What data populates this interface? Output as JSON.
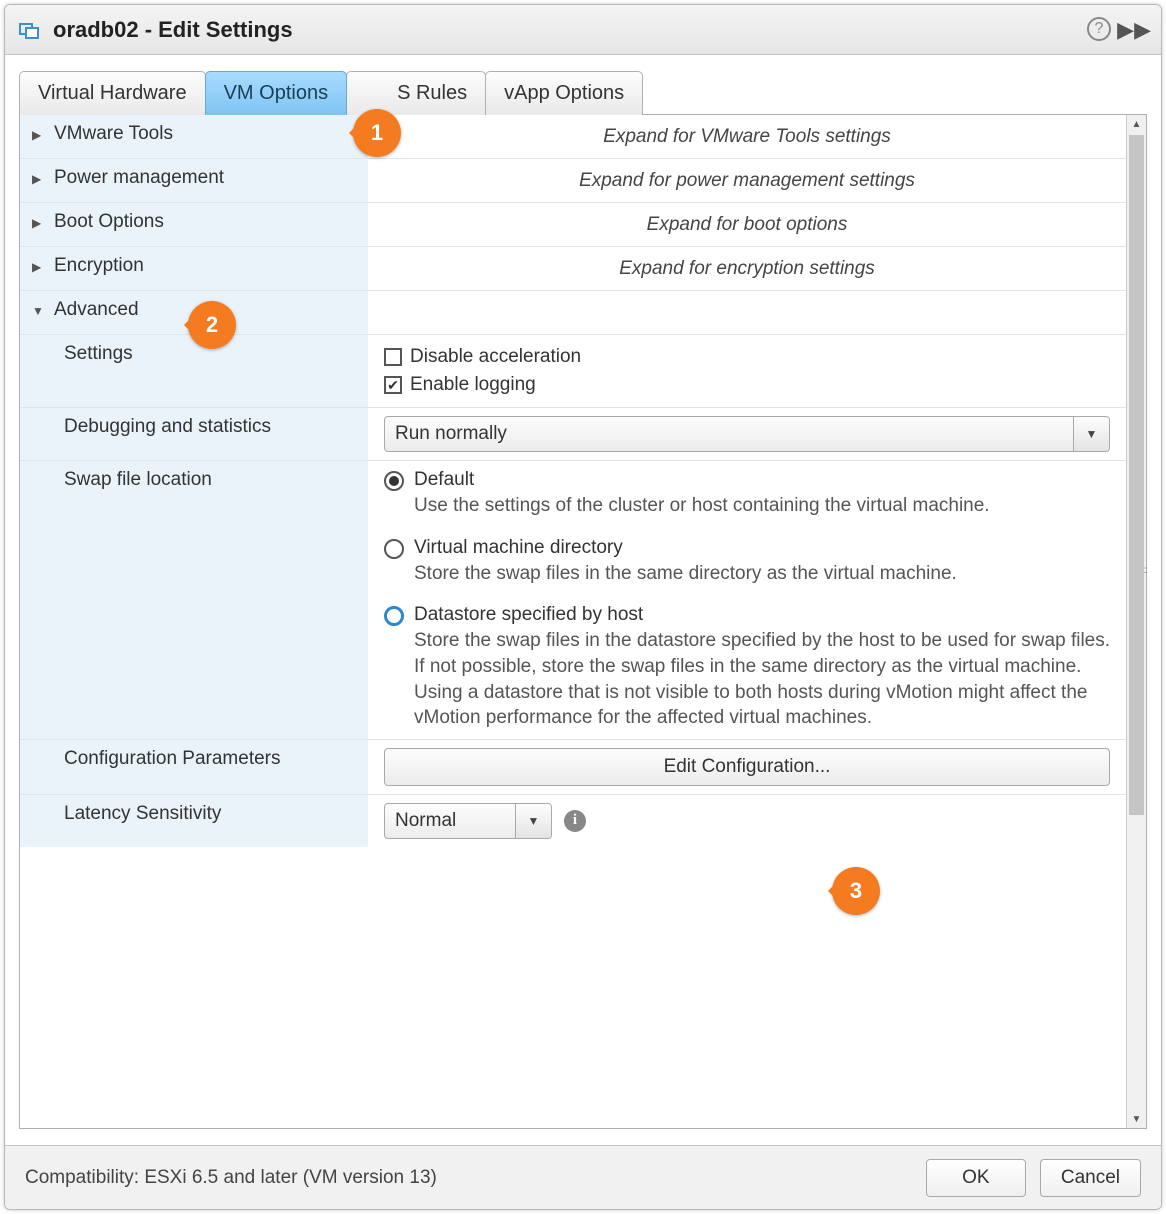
{
  "title": "oradb02 - Edit Settings",
  "tabs": {
    "virtual_hardware": "Virtual Hardware",
    "vm_options": "VM Options",
    "sdrs_rules": "S Rules",
    "vapp_options": "vApp Options"
  },
  "sections": {
    "vmware_tools": {
      "label": "VMware Tools",
      "hint": "Expand for VMware Tools settings"
    },
    "power_mgmt": {
      "label": "Power management",
      "hint": "Expand for power management settings"
    },
    "boot_options": {
      "label": "Boot Options",
      "hint": "Expand for boot options"
    },
    "encryption": {
      "label": "Encryption",
      "hint": "Expand for encryption settings"
    },
    "advanced": {
      "label": "Advanced"
    }
  },
  "advanced": {
    "settings_label": "Settings",
    "disable_acceleration": "Disable acceleration",
    "enable_logging": "Enable logging",
    "debug_label": "Debugging and statistics",
    "debug_value": "Run normally",
    "swap_label": "Swap file location",
    "swap_options": {
      "default_title": "Default",
      "default_desc": "Use the settings of the cluster or host containing the virtual machine.",
      "vmdir_title": "Virtual machine directory",
      "vmdir_desc": "Store the swap files in the same directory as the virtual machine.",
      "host_title": "Datastore specified by host",
      "host_desc": "Store the swap files in the datastore specified by the host to be used for swap files. If not possible, store the swap files in the same directory as the virtual machine. Using a datastore that is not visible to both hosts during vMotion might affect the vMotion performance for the affected virtual machines."
    },
    "config_params_label": "Configuration Parameters",
    "edit_config_btn": "Edit Configuration...",
    "latency_label": "Latency Sensitivity",
    "latency_value": "Normal"
  },
  "footer": {
    "compat": "Compatibility: ESXi 6.5 and later (VM version 13)",
    "ok": "OK",
    "cancel": "Cancel"
  },
  "callouts": {
    "one": "1",
    "two": "2",
    "three": "3"
  }
}
